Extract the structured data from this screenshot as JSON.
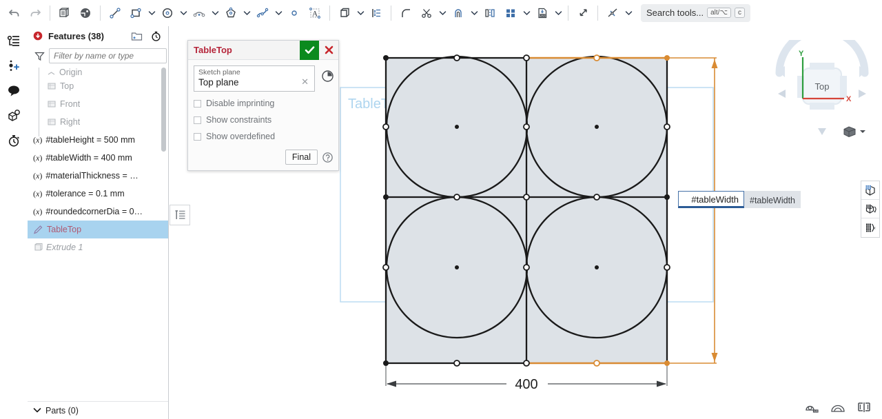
{
  "toolbar": {
    "tools": [
      {
        "name": "undo-icon",
        "title": "Undo"
      },
      {
        "name": "redo-icon",
        "title": "Redo"
      },
      {
        "name": "sketch-copy-icon",
        "title": "Copy sketch"
      },
      {
        "name": "appearance-icon",
        "title": "Appearance"
      },
      {
        "name": "line-icon",
        "title": "Line"
      },
      {
        "name": "rectangle-icon",
        "title": "Corner rectangle"
      },
      {
        "name": "circle-icon",
        "title": "Circle"
      },
      {
        "name": "arc-icon",
        "title": "Arc"
      },
      {
        "name": "polygon-icon",
        "title": "Polygon"
      },
      {
        "name": "spline-icon",
        "title": "Spline"
      },
      {
        "name": "point-icon",
        "title": "Point"
      },
      {
        "name": "text-icon",
        "title": "Text"
      },
      {
        "name": "use-project-icon",
        "title": "Use (project/convert)"
      },
      {
        "name": "dimension-icon",
        "title": "Dimension"
      },
      {
        "name": "fillet-icon",
        "title": "Sketch fillet"
      },
      {
        "name": "trim-icon",
        "title": "Trim"
      },
      {
        "name": "offset-icon",
        "title": "Offset"
      },
      {
        "name": "mirror-icon",
        "title": "Mirror"
      },
      {
        "name": "linear-pattern-icon",
        "title": "Linear pattern"
      },
      {
        "name": "dxf-import-icon",
        "title": "Import DXF"
      },
      {
        "name": "transform-icon",
        "title": "Transform entities"
      },
      {
        "name": "constraint-icon",
        "title": "Constraints"
      }
    ],
    "search": {
      "placeholder": "Search tools...",
      "shortcut_mod": "alt/⌥",
      "shortcut_key": "c"
    }
  },
  "rail": {
    "items": [
      {
        "name": "feature-list-icon",
        "label": "Feature list"
      },
      {
        "name": "add-point-icon",
        "label": "Add point"
      },
      {
        "name": "comments-icon",
        "label": "Comments"
      },
      {
        "name": "part-info-icon",
        "label": "Part info"
      },
      {
        "name": "history-icon",
        "label": "History"
      }
    ]
  },
  "features_panel": {
    "title": "Features (38)",
    "title_badge": "rollback-icon",
    "header_icons": [
      {
        "name": "new-folder-icon"
      },
      {
        "name": "measure-timer-icon"
      }
    ],
    "filter": {
      "icon": "filter-icon",
      "placeholder": "Filter by name or type",
      "value": ""
    },
    "tree": [
      {
        "label": "Origin",
        "icon": "origin-icon",
        "style": "muted",
        "indent": true,
        "partial": true
      },
      {
        "label": "Top",
        "icon": "plane-icon",
        "style": "muted",
        "indent": true
      },
      {
        "label": "Front",
        "icon": "plane-icon",
        "style": "muted",
        "indent": true
      },
      {
        "label": "Right",
        "icon": "plane-icon",
        "style": "muted",
        "indent": true
      },
      {
        "label": "#tableHeight = 500 mm",
        "icon": "variable-icon",
        "style": "normal"
      },
      {
        "label": "#tableWidth = 400 mm",
        "icon": "variable-icon",
        "style": "normal"
      },
      {
        "label": "#materialThickness = …",
        "icon": "variable-icon",
        "style": "normal"
      },
      {
        "label": "#tolerance = 0.1 mm",
        "icon": "variable-icon",
        "style": "normal"
      },
      {
        "label": "#roundedcornerDia = 0…",
        "icon": "variable-icon",
        "style": "normal"
      },
      {
        "label": "TableTop",
        "icon": "sketch-icon",
        "style": "pink",
        "selected": true
      },
      {
        "label": "Extrude 1",
        "icon": "extrude-icon",
        "style": "italic"
      }
    ],
    "parts": {
      "label": "Parts (0)",
      "expanded": true
    }
  },
  "sketch_dialog": {
    "title": "TableTop",
    "accept_icon": "checkmark-icon",
    "cancel_icon": "close-icon",
    "plane_field": {
      "label": "Sketch plane",
      "value": "Top plane",
      "clear_icon": "clear-x-icon"
    },
    "history_icon": "sketch-history-icon",
    "checkboxes": [
      {
        "label": "Disable imprinting",
        "checked": false
      },
      {
        "label": "Show constraints",
        "checked": false
      },
      {
        "label": "Show overdefined",
        "checked": false
      }
    ],
    "final_button": "Final",
    "help_icon": "help-icon"
  },
  "canvas": {
    "sketch_label": "TableTop",
    "sketch_plane_tint": "#cfe4f5",
    "horizontal_dimension": "400",
    "vertical_dimension_color": "#d98b33",
    "shape_fill": "#dde2e7",
    "shape_stroke": "#1a1a1a",
    "sketch_tool_list_icon": "sketch-tool-list-icon"
  },
  "dimension_editor": {
    "value": "#tableWidth",
    "suggestion": "#tableWidth"
  },
  "viewcube": {
    "face_label": "Top",
    "axis_x": "X",
    "axis_y": "Y",
    "axis_x_color": "#d6453a",
    "axis_y_color": "#2e9e3e",
    "dropdown_icon": "view-cube-dropdown-icon"
  },
  "right_strip": {
    "buttons": [
      {
        "name": "appearance-grid-icon"
      },
      {
        "name": "mesh-rotate-icon"
      },
      {
        "name": "mesh-scale-icon"
      }
    ]
  },
  "bottom_tools": {
    "buttons": [
      {
        "name": "measure-tape-icon"
      },
      {
        "name": "protractor-icon"
      },
      {
        "name": "mass-properties-icon"
      }
    ]
  }
}
